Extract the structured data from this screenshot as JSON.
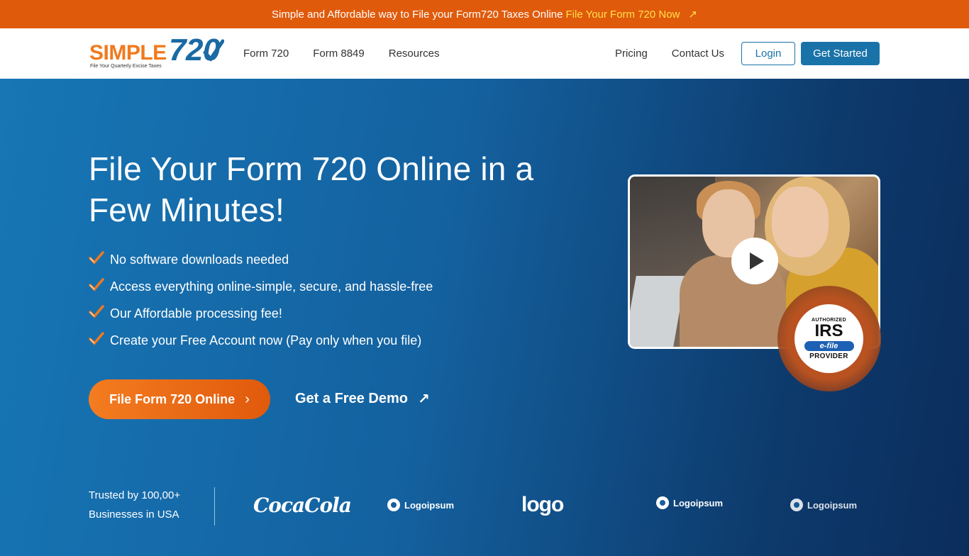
{
  "banner": {
    "text": "Simple and Affordable way to File your Form720 Taxes Online",
    "link": "File Your Form 720 Now",
    "arrow": "↗"
  },
  "logo": {
    "word": "SIMPLE",
    "number": "720",
    "tagline": "File Your Quarterly Excise Taxes"
  },
  "nav": {
    "left": [
      "Form 720",
      "Form 8849",
      "Resources"
    ],
    "pricing": "Pricing",
    "contact": "Contact Us",
    "login": "Login",
    "get_started": "Get Started"
  },
  "hero": {
    "title": "File Your Form 720 Online in a Few Minutes!",
    "features": [
      "No software downloads needed",
      "Access everything online-simple, secure, and hassle-free",
      "Our Affordable processing fee!",
      "Create your Free Account now (Pay only when you file)"
    ],
    "cta": "File Form 720 Online",
    "cta_chevron": "›",
    "demo": "Get a Free Demo",
    "demo_arrow": "↗"
  },
  "badge": {
    "line1": "AUTHORIZED",
    "line2": "IRS",
    "efile": "e-file",
    "line3": "PROVIDER"
  },
  "trusted": {
    "line1": "Trusted by 100,00+",
    "line2": "Businesses in USA"
  },
  "partners": {
    "p1": "CocaCola",
    "p2": "Logoipsum",
    "p3": "logo",
    "p4": "Logoipsum",
    "p5": "Logoipsum"
  },
  "colors": {
    "banner": "#e05a0c",
    "link": "#ffe14a",
    "primary": "#1a73a8",
    "cta": "#f47c20"
  }
}
